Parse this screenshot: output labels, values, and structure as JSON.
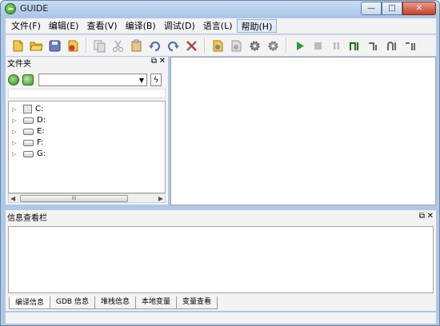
{
  "window": {
    "title": "GUIDE"
  },
  "window_controls": {
    "minimize": "—",
    "maximize": "□",
    "close": "✕"
  },
  "menu": [
    {
      "label": "文件(F)"
    },
    {
      "label": "编辑(E)"
    },
    {
      "label": "查看(V)"
    },
    {
      "label": "编译(B)"
    },
    {
      "label": "调试(D)"
    },
    {
      "label": "语言(L)"
    },
    {
      "label": "帮助(H)"
    }
  ],
  "toolbar": {
    "icons": [
      "new-file-icon",
      "open-folder-icon",
      "save-icon",
      "save-all-icon",
      "separator",
      "copy-icon",
      "cut-icon",
      "paste-icon",
      "undo-icon",
      "redo-icon",
      "tools-icon",
      "separator",
      "compile-icon",
      "build-icon",
      "debug-gear-icon",
      "settings-gear-icon",
      "separator",
      "run-icon",
      "stop-icon",
      "pause-icon",
      "step-into-icon",
      "step-over-icon",
      "step-out-icon",
      "step-return-icon"
    ]
  },
  "file_panel": {
    "title": "文件夹",
    "float_icon": "⧉",
    "close_icon": "✕",
    "dropdown_value": "",
    "tree": [
      {
        "label": "C:",
        "type": "system-drive"
      },
      {
        "label": "D:",
        "type": "drive"
      },
      {
        "label": "E:",
        "type": "drive"
      },
      {
        "label": "F:",
        "type": "drive"
      },
      {
        "label": "G:",
        "type": "drive"
      }
    ],
    "scroll_grip": "III"
  },
  "info_panel": {
    "title": "信息查看栏",
    "float_icon": "⧉",
    "close_icon": "✕",
    "tabs": [
      {
        "label": "编译信息",
        "active": true
      },
      {
        "label": "GDB 信息",
        "active": false
      },
      {
        "label": "堆栈信息",
        "active": false
      },
      {
        "label": "本地变量",
        "active": false
      },
      {
        "label": "变量查看",
        "active": false
      }
    ]
  },
  "colors": {
    "titlebar": "#aec8e6",
    "panel": "#f3f3f3",
    "run_green": "#2e9c2e"
  }
}
